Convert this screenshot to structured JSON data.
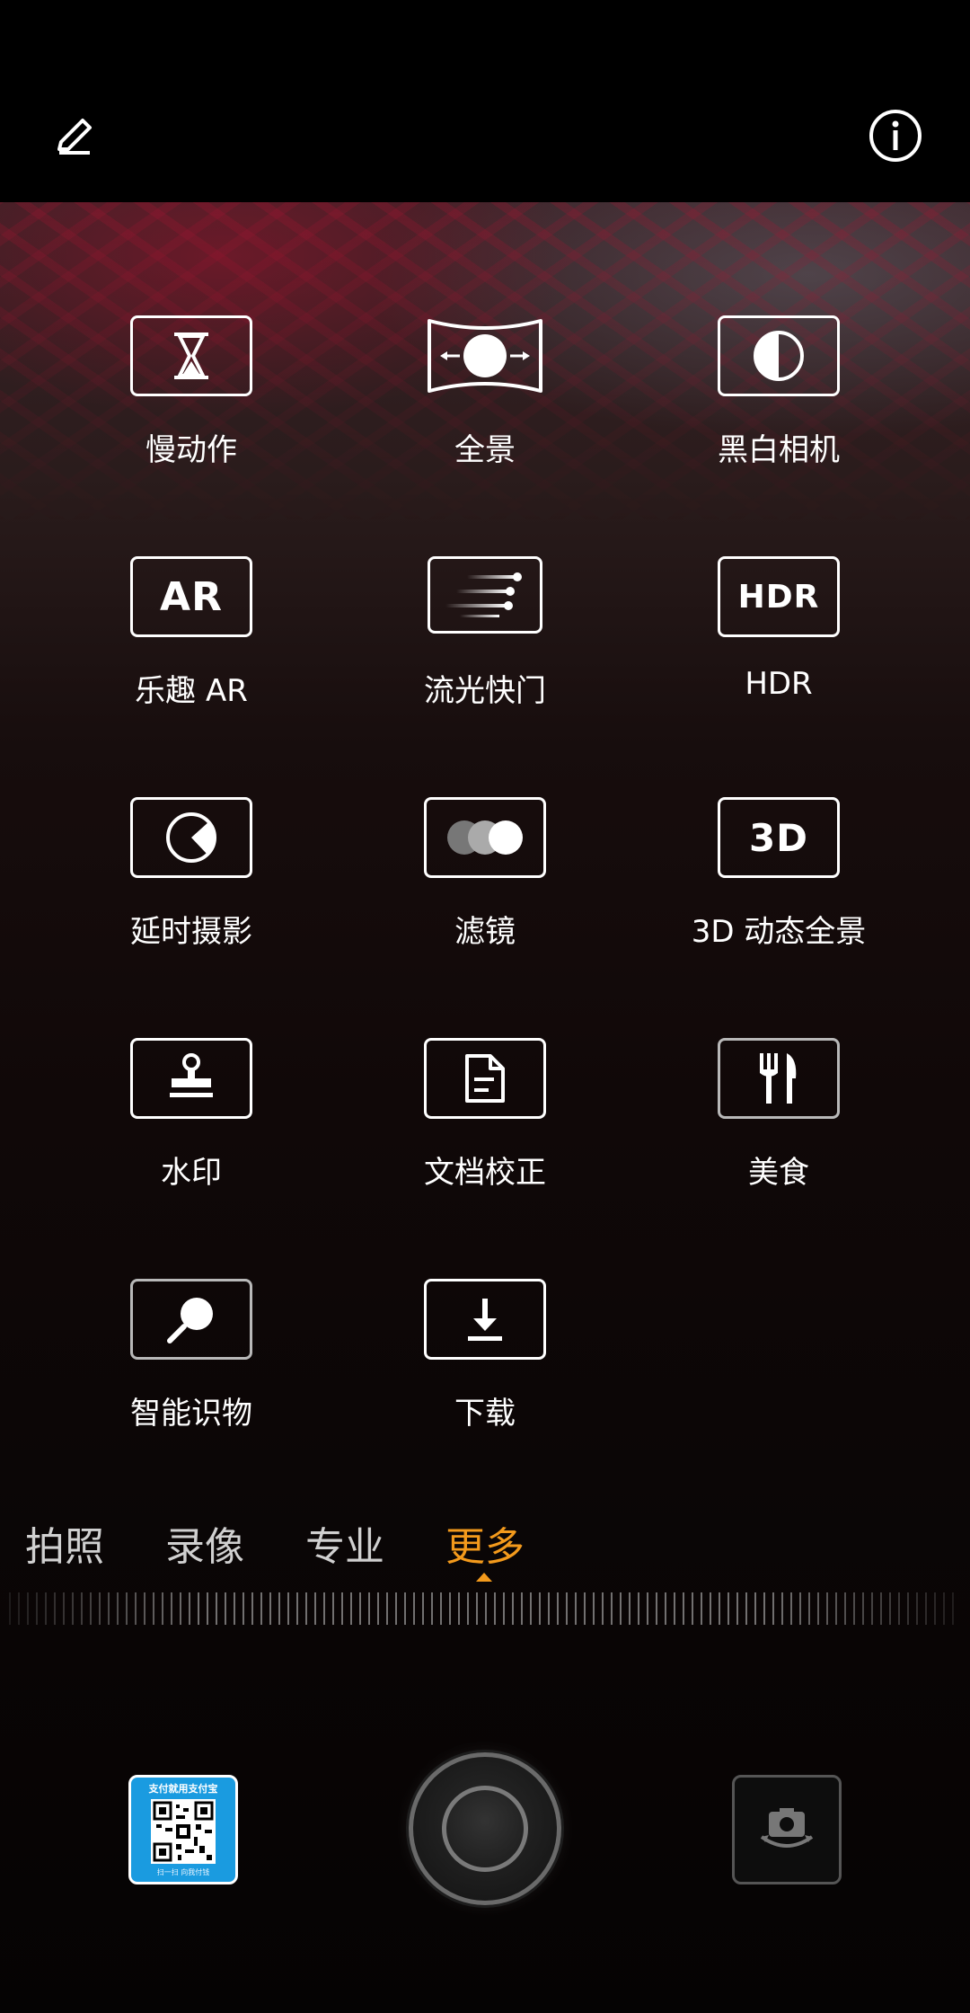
{
  "top_bar": {
    "edit_icon": "pencil-icon",
    "info_icon": "info-icon"
  },
  "modes": [
    {
      "label": "慢动作",
      "icon": "hourglass-icon"
    },
    {
      "label": "全景",
      "icon": "panorama-icon"
    },
    {
      "label": "黑白相机",
      "icon": "half-circle-icon"
    },
    {
      "label": "乐趣 AR",
      "icon": "ar-icon",
      "icon_text": "AR"
    },
    {
      "label": "流光快门",
      "icon": "light-trails-icon"
    },
    {
      "label": "HDR",
      "icon": "hdr-icon",
      "icon_text": "HDR"
    },
    {
      "label": "延时摄影",
      "icon": "timelapse-icon"
    },
    {
      "label": "滤镜",
      "icon": "filter-icon"
    },
    {
      "label": "3D 动态全景",
      "icon": "3d-icon",
      "icon_text": "3D"
    },
    {
      "label": "水印",
      "icon": "stamp-icon"
    },
    {
      "label": "文档校正",
      "icon": "document-icon"
    },
    {
      "label": "美食",
      "icon": "fork-knife-icon"
    },
    {
      "label": "智能识物",
      "icon": "magnifier-icon"
    },
    {
      "label": "下载",
      "icon": "download-icon"
    }
  ],
  "mode_tabs": {
    "items": [
      "拍照",
      "录像",
      "专业",
      "更多"
    ],
    "active": "更多"
  },
  "gallery_thumbnail": {
    "title": "支付就用支付宝",
    "subtitle": "扫一扫 向我付钱"
  },
  "colors": {
    "accent": "#f39a1c",
    "background": "#000000",
    "icon_stroke": "#ffffff",
    "thumbnail_blue": "#1a9be0"
  }
}
